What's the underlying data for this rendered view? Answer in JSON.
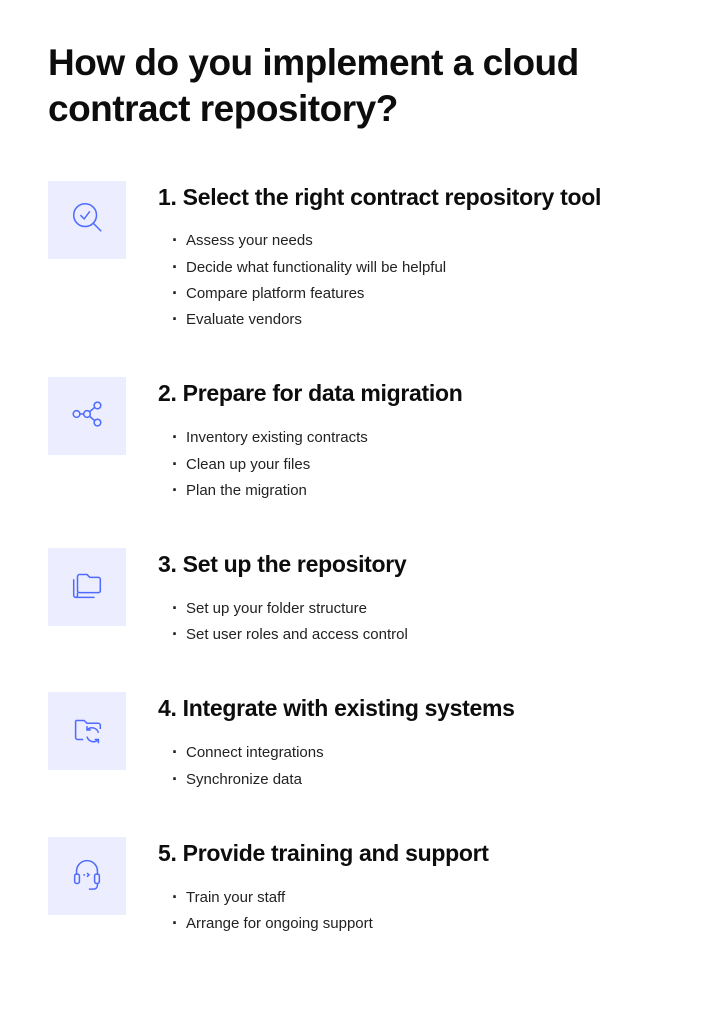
{
  "title": "How do you implement a cloud contract repository?",
  "steps": [
    {
      "heading": "1. Select the right contract repository tool",
      "items": [
        "Assess your needs",
        "Decide what functionality will be helpful",
        "Compare platform features",
        "Evaluate vendors"
      ]
    },
    {
      "heading": "2. Prepare for data migration",
      "items": [
        "Inventory existing contracts",
        "Clean up your files",
        "Plan the migration"
      ]
    },
    {
      "heading": "3. Set up the repository",
      "items": [
        "Set up your folder structure",
        "Set user roles and access control"
      ]
    },
    {
      "heading": "4. Integrate with existing systems",
      "items": [
        "Connect integrations",
        "Synchronize data"
      ]
    },
    {
      "heading": "5. Provide training and support",
      "items": [
        "Train your staff",
        "Arrange for ongoing support"
      ]
    }
  ]
}
